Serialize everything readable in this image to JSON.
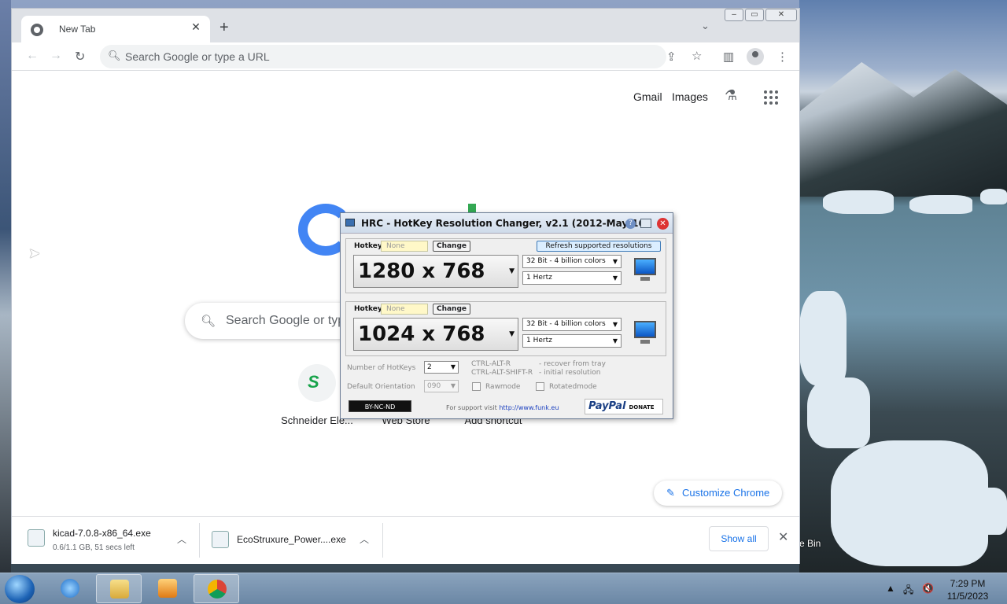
{
  "browser": {
    "tab_title": "New Tab",
    "omnibox_placeholder": "Search Google or type a URL",
    "top_links": [
      "Gmail",
      "Images"
    ],
    "search_placeholder": "Search Google or type a URL",
    "shortcuts": [
      {
        "label": "Schneider Ele..."
      },
      {
        "label": "Web Store"
      },
      {
        "label": "Add shortcut"
      }
    ],
    "customize_label": "Customize Chrome"
  },
  "downloads": {
    "items": [
      {
        "name": "kicad-7.0.8-x86_64.exe",
        "status": "0.6/1.1 GB, 51 secs left"
      },
      {
        "name": "EcoStruxure_Power....exe",
        "status": ""
      }
    ],
    "show_all": "Show all"
  },
  "hrc": {
    "title": "HRC - HotKey Resolution Changer, v2.1 (2012-May-16)",
    "refresh_label": "Refresh supported resolutions",
    "profiles": [
      {
        "hotkey_label": "Hotkey",
        "hotkey_value": "None",
        "change_label": "Change",
        "resolution": "1280 x 768",
        "color_depth": "32 Bit - 4 billion colors",
        "refresh_rate": "1 Hertz"
      },
      {
        "hotkey_label": "Hotkey",
        "hotkey_value": "None",
        "change_label": "Change",
        "resolution": "1024 x 768",
        "color_depth": "32 Bit - 4 billion colors",
        "refresh_rate": "1 Hertz"
      }
    ],
    "num_hotkeys_label": "Number of HotKeys",
    "num_hotkeys_value": "2",
    "orientation_label": "Default Orientation",
    "orientation_value": "090",
    "hint1_key": "CTRL-ALT-R",
    "hint1_desc": "- recover from tray",
    "hint2_key": "CTRL-ALT-SHIFT-R",
    "hint2_desc": "- initial resolution",
    "rawmode_label": "Rawmode",
    "rotated_label": "Rotatedmode",
    "license_badge": "BY-NC-ND",
    "support_text": "For support visit",
    "support_link": "http://www.funk.eu",
    "paypal_label": "PayPal",
    "donate_label": "DONATE"
  },
  "desktop": {
    "recycle_label": "e Bin"
  },
  "taskbar": {
    "time": "7:29 PM",
    "date": "11/5/2023"
  }
}
